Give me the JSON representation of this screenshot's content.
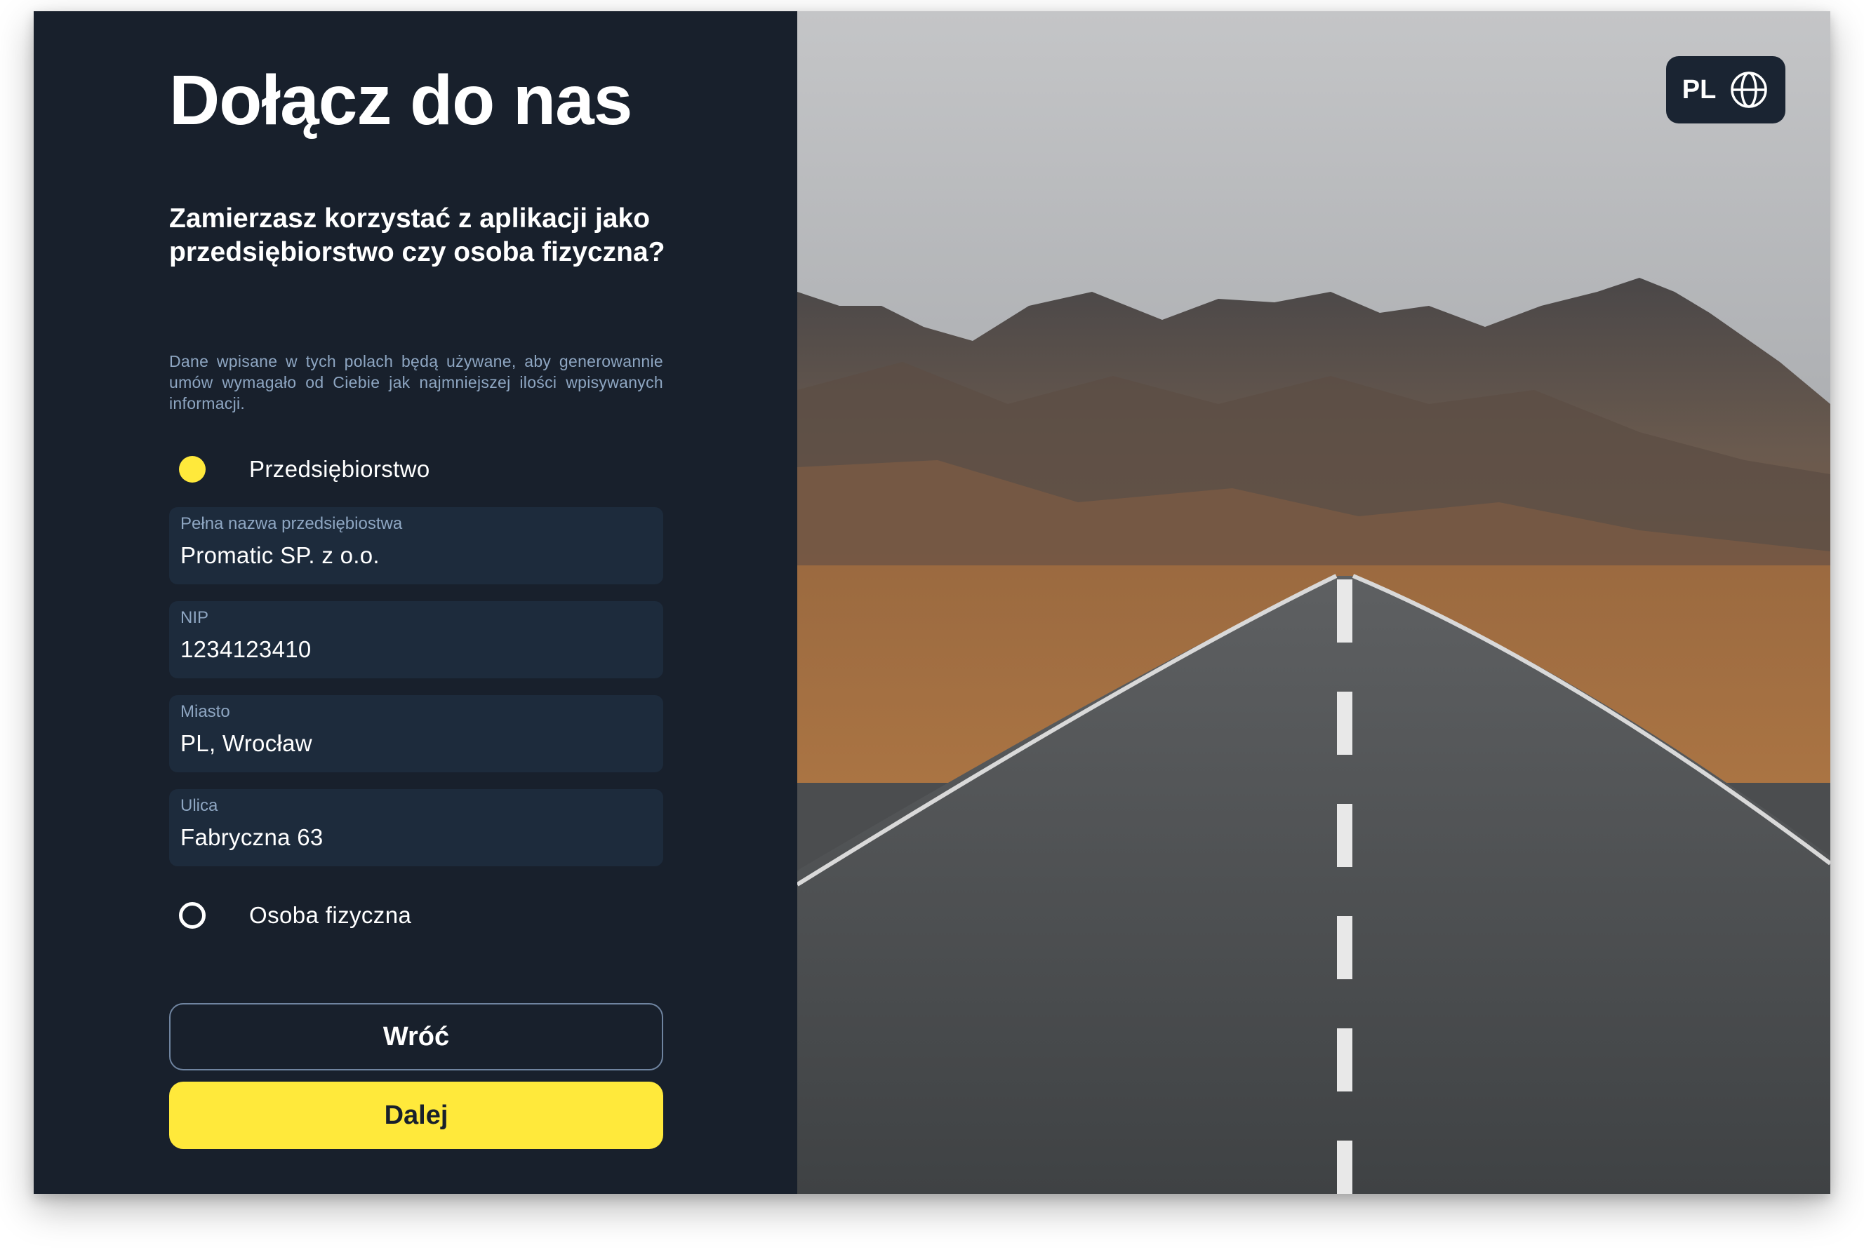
{
  "header": {
    "title": "Dołącz do nas"
  },
  "form": {
    "question": "Zamierzasz korzystać z aplikacji jako przedsiębiorstwo czy osoba fizyczna?",
    "info": "Dane wpisane w tych polach będą używane, aby generowannie umów wymagało od Ciebie jak najmniejszej ilości wpisywanych informacji.",
    "options": {
      "company": {
        "label": "Przedsiębiorstwo",
        "selected": true
      },
      "person": {
        "label": "Osoba fizyczna",
        "selected": false
      }
    },
    "fields": [
      {
        "label": "Pełna nazwa przedsiębiostwa",
        "value": "Promatic SP. z o.o."
      },
      {
        "label": "NIP",
        "value": "1234123410"
      },
      {
        "label": "Miasto",
        "value": "PL, Wrocław"
      },
      {
        "label": "Ulica",
        "value": "Fabryczna 63"
      }
    ],
    "back_label": "Wróć",
    "next_label": "Dalej"
  },
  "language": {
    "code": "PL",
    "icon": "globe-icon"
  },
  "colors": {
    "panel_bg": "#18202c",
    "field_bg": "#1d2b3c",
    "accent": "#ffe93b",
    "muted_text": "#8ea6c2"
  }
}
